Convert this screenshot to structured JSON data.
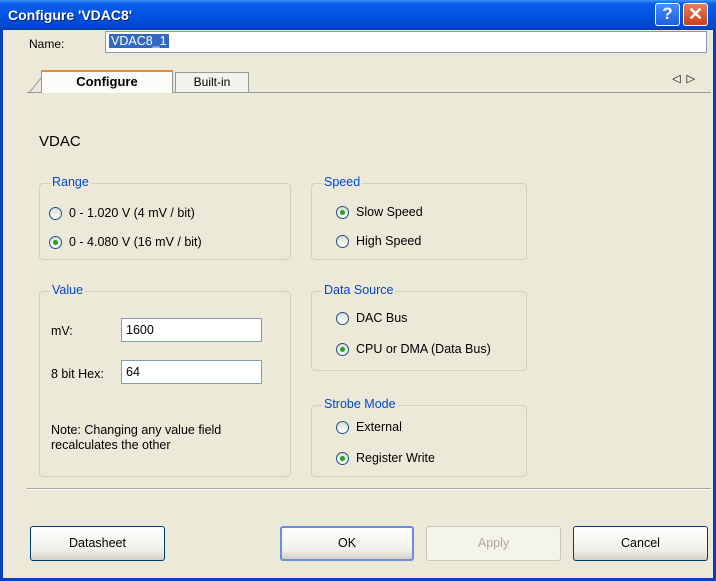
{
  "window": {
    "title": "Configure 'VDAC8'",
    "help_glyph": "?",
    "close_glyph": "✕"
  },
  "name": {
    "label": "Name:",
    "value": "VDAC8_1"
  },
  "tabs": [
    {
      "label": "Configure",
      "selected": true
    },
    {
      "label": "Built-in",
      "selected": false
    }
  ],
  "tab_scroll": {
    "left": "◁",
    "right": "▷"
  },
  "component_label": "VDAC",
  "range": {
    "title": "Range",
    "options": [
      {
        "label": "0 - 1.020 V (4 mV / bit)",
        "checked": false
      },
      {
        "label": "0 - 4.080 V (16 mV / bit)",
        "checked": true
      }
    ]
  },
  "value": {
    "title": "Value",
    "mv_label": "mV:",
    "mv_value": "1600",
    "hex_label": "8 bit Hex:",
    "hex_value": "64",
    "note": "Note: Changing any value field recalculates the other"
  },
  "speed": {
    "title": "Speed",
    "options": [
      {
        "label": "Slow Speed",
        "checked": true
      },
      {
        "label": "High Speed",
        "checked": false
      }
    ]
  },
  "data_source": {
    "title": "Data Source",
    "options": [
      {
        "label": "DAC Bus",
        "checked": false
      },
      {
        "label": "CPU or DMA (Data Bus)",
        "checked": true
      }
    ]
  },
  "strobe_mode": {
    "title": "Strobe Mode",
    "options": [
      {
        "label": "External",
        "checked": false
      },
      {
        "label": "Register Write",
        "checked": true
      }
    ]
  },
  "buttons": {
    "datasheet": "Datasheet",
    "ok": "OK",
    "apply": "Apply",
    "cancel": "Cancel"
  },
  "colors": {
    "title_bar": "#0054e3",
    "group_title": "#0046d5",
    "dialog_bg": "#ece9d8",
    "selection": "#316ac5"
  }
}
